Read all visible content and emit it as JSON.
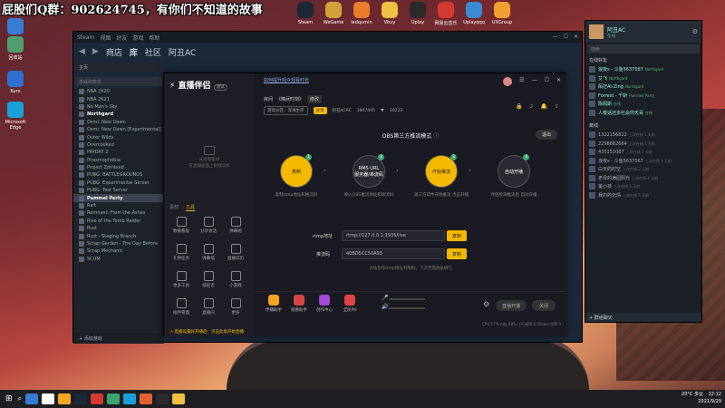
{
  "overlay": {
    "text": "屁股们Q群：902624745，有你们不知道的故事"
  },
  "desktop_icons": [
    {
      "label": "此电脑",
      "color": "#3a7bd5"
    },
    {
      "label": "回收站",
      "color": "#4f9e6f"
    },
    {
      "label": "Kuro",
      "color": "#2f6fd1"
    },
    {
      "label": "Microsoft Edge",
      "color": "#1aa0d8"
    }
  ],
  "top_icons": [
    {
      "label": "Steam",
      "color": "#1b2838"
    },
    {
      "label": "WeGame",
      "color": "#d2a13a"
    },
    {
      "label": "ledqumin",
      "color": "#ea7c2a"
    },
    {
      "label": "Vbuy",
      "color": "#f0c040"
    },
    {
      "label": "Uplay",
      "color": "#2a2a2a"
    },
    {
      "label": "网易云音乐",
      "color": "#d33a31"
    },
    {
      "label": "Uplayqqq",
      "color": "#3a8ad4"
    },
    {
      "label": "UXGroup",
      "color": "#f0a030"
    }
  ],
  "steam": {
    "menu": [
      "Steam",
      "视图",
      "好友",
      "游戏",
      "帮助"
    ],
    "nav": [
      "商店",
      "库",
      "社区",
      "阿丑AC"
    ],
    "home": "主页",
    "search_placeholder": "游戏和软件",
    "games": [
      {
        "name": "NBA 2K20",
        "group": false,
        "active": false
      },
      {
        "name": "NBA 2K21",
        "group": false,
        "active": false
      },
      {
        "name": "No Man's Sky",
        "group": false,
        "active": false
      },
      {
        "name": "Northgard",
        "group": true,
        "active": false
      },
      {
        "name": "Osmi: New Dawn",
        "group": false,
        "active": false
      },
      {
        "name": "Osmi: New Dawn [Experimental]",
        "group": false,
        "active": false
      },
      {
        "name": "Outer Wilds",
        "group": false,
        "active": false
      },
      {
        "name": "Overcooked",
        "group": false,
        "active": false
      },
      {
        "name": "PAYDAY 2",
        "group": false,
        "active": false
      },
      {
        "name": "Phasmophobia",
        "group": false,
        "active": false
      },
      {
        "name": "Project Zomboid",
        "group": false,
        "active": false
      },
      {
        "name": "PUBG: BATTLEGROUNDS",
        "group": false,
        "active": false
      },
      {
        "name": "PUBG: Experimental Server",
        "group": false,
        "active": false
      },
      {
        "name": "PUBG: Test Server",
        "group": false,
        "active": false
      },
      {
        "name": "Pummel Party",
        "group": true,
        "active": true
      },
      {
        "name": "Raft",
        "group": false,
        "active": false
      },
      {
        "name": "Remnant: From the Ashes",
        "group": false,
        "active": false
      },
      {
        "name": "Rise of the Tomb Raider",
        "group": false,
        "active": false
      },
      {
        "name": "Rust",
        "group": false,
        "active": false
      },
      {
        "name": "Rust - Staging Branch",
        "group": false,
        "active": false
      },
      {
        "name": "Scrap Garden - The Day Before",
        "group": false,
        "active": false
      },
      {
        "name": "Scrap Mechanic",
        "group": false,
        "active": false
      },
      {
        "name": "SCUM",
        "group": false,
        "active": false
      }
    ],
    "add_game": "添加游戏"
  },
  "zhibo": {
    "logo": "直播伴侣",
    "badge": "测试",
    "placeholder_line1": "从右侧素材",
    "placeholder_line2": "在直播画面上拖拽添加",
    "tabs": [
      "素材",
      "工具"
    ],
    "tools": [
      "数据看板",
      "分享会话",
      "弹幕姬",
      "礼物任务",
      "弹幕墙",
      "直播日历",
      "更多工具",
      "低延迟",
      "小游戏",
      "插件管理",
      "直播间",
      "更多"
    ],
    "room_label": "房间",
    "room_title": "《精武时刻》",
    "room_edit": "修改",
    "room_tag": "游戏分区：深海生存",
    "room_id_label": "阿丑ACAC",
    "room_id": "3907495",
    "room_fans": "20223",
    "banner_link": "如何提升观众观看时长",
    "mode_title": "OBS第三方推流模式",
    "exit_btn": "退出",
    "steps": [
      {
        "num": "1",
        "label": "复制",
        "desc": "复制rtmp地址和推流码"
      },
      {
        "num": "2",
        "label": "RMS URL",
        "label2": "服务器/串流码",
        "desc": "填入OBS推流地址和串流码"
      },
      {
        "num": "3",
        "label": "开始推流",
        "desc": "第三方软件开始推流 点击开播"
      },
      {
        "num": "4",
        "label": "自动开播",
        "desc": "伴侣检测推流后 自动开播"
      }
    ],
    "rtmp_label": "rtmp地址",
    "rtmp_value": "rtmp://127.0.0.1:1935/live",
    "key_label": "推流码",
    "key_value": "40BD5CC50A93",
    "copy_label": "复制",
    "hint": "大陆合作rtmp地址有限制，下次无需重复填写",
    "bottom_items": [
      {
        "label": "伴播助手",
        "color": "#f5a623"
      },
      {
        "label": "观看助手",
        "color": "#d64545"
      },
      {
        "label": "创作中心",
        "color": "#a548d6"
      },
      {
        "label": "全民PK",
        "color": "#e04545"
      }
    ],
    "settings_label": "设置",
    "live_btn": "直播开播",
    "stop_btn": "关闭",
    "status_bar": "CPU:17%  内存:68%  上行速率:0.00kb/s  帧率:0",
    "notice": "直播设置好开播后：点击此处开始直播"
  },
  "friends": {
    "username": "阿丑AC",
    "status": "在线",
    "search_placeholder": "搜索",
    "online_header": "在线好友",
    "online": [
      {
        "name": "浪夜s - 斗鱼5637567",
        "status": "Northgard"
      },
      {
        "name": "艾飞",
        "status": "Northgard"
      },
      {
        "name": "陌茫AI-Zing",
        "status": "Northgard"
      },
      {
        "name": "Forrest - 千斩",
        "status": "Pummel Party"
      },
      {
        "name": "陈佩斯",
        "status": "在线"
      },
      {
        "name": "人傻话还多社会你天哥",
        "status": "在线"
      }
    ],
    "offline_header": "离线",
    "offline": [
      {
        "name": "1322156822",
        "status": "上次在线 1 天前"
      },
      {
        "name": "2298882664",
        "status": "上次在线 2 天前"
      },
      {
        "name": "435152087",
        "status": "上次在线 2 天前"
      },
      {
        "name": "浪夜s - 斗鱼5637567",
        "status": "上次在线 3 天前"
      },
      {
        "name": "白天的时空",
        "status": "上次在线 3 天前"
      },
      {
        "name": "老母的满园阳光",
        "status": "上次在线 4 天前"
      },
      {
        "name": "萤小孩",
        "status": "上次在线 5 天前"
      },
      {
        "name": "我的的无情",
        "status": "上次在线 6 天前"
      }
    ],
    "group_chat": "群组聊天"
  },
  "taskbar": {
    "weather": "20°C 多云",
    "time": "22:12",
    "date": "2021/9/29",
    "icons": [
      "#3a7bd5",
      "#ffffff",
      "#f5a623",
      "#1b2838",
      "#d33a31",
      "#3ca56e",
      "#1aa0d8",
      "#e06030",
      "#2a2a2a",
      "#f0c040"
    ]
  }
}
